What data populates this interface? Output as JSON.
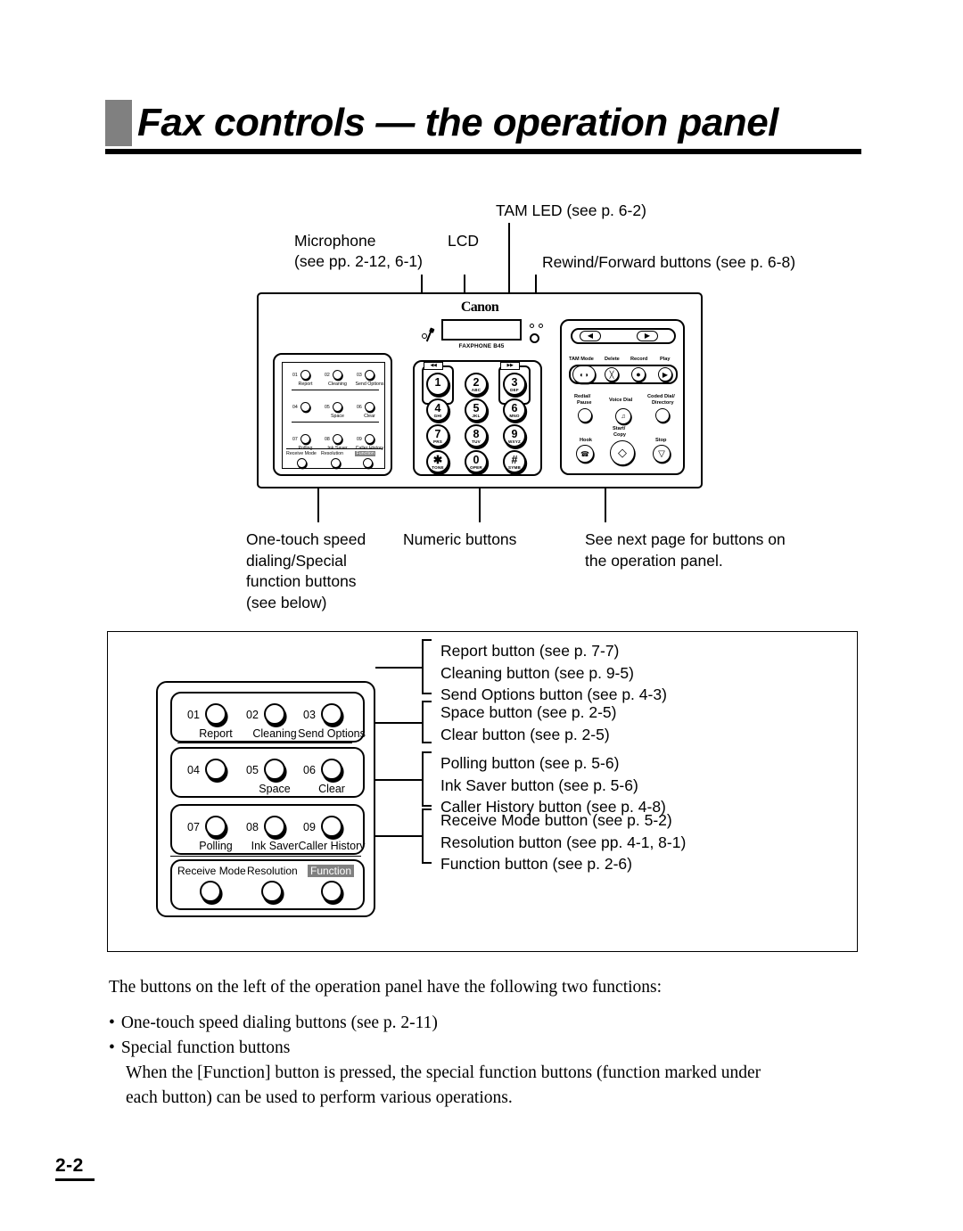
{
  "page": {
    "title": "Fax controls — the operation panel",
    "page_number": "2-2"
  },
  "diagram_top": {
    "callouts": {
      "tam_led": "TAM LED (see p. 6-2)",
      "microphone_line1": "Microphone",
      "microphone_line2": "(see pp. 2-12, 6-1)",
      "lcd": "LCD",
      "rewind_forward": "Rewind/Forward buttons (see p. 6-8)"
    },
    "bottom_callouts": {
      "one_touch_l1": "One-touch speed",
      "one_touch_l2": "dialing/Special",
      "one_touch_l3": "function buttons",
      "one_touch_l4": "(see below)",
      "numeric": "Numeric buttons",
      "next_page_l1": "See next page for buttons on",
      "next_page_l2": "the operation panel."
    }
  },
  "device": {
    "brand": "Canon",
    "model": "FAXPHONE B45",
    "one_touch_buttons": [
      {
        "num": "01",
        "label": "Report"
      },
      {
        "num": "02",
        "label": "Cleaning"
      },
      {
        "num": "03",
        "label": "Send Options"
      },
      {
        "num": "04",
        "label": ""
      },
      {
        "num": "05",
        "label": "Space"
      },
      {
        "num": "06",
        "label": "Clear"
      },
      {
        "num": "07",
        "label": "Polling"
      },
      {
        "num": "08",
        "label": "Ink Saver"
      },
      {
        "num": "09",
        "label": "Caller History"
      }
    ],
    "function_row": [
      {
        "label": "Receive Mode",
        "inverted": false
      },
      {
        "label": "Resolution",
        "inverted": false
      },
      {
        "label": "Function",
        "inverted": true
      }
    ],
    "keypad": [
      {
        "digit": "1",
        "letters": ""
      },
      {
        "digit": "2",
        "letters": "ABC"
      },
      {
        "digit": "3",
        "letters": "DEF"
      },
      {
        "digit": "4",
        "letters": "GHI"
      },
      {
        "digit": "5",
        "letters": "JKL"
      },
      {
        "digit": "6",
        "letters": "MNO"
      },
      {
        "digit": "7",
        "letters": "PRS"
      },
      {
        "digit": "8",
        "letters": "TUV"
      },
      {
        "digit": "9",
        "letters": "WXYZ"
      },
      {
        "digit": "✱",
        "letters": "TONE"
      },
      {
        "digit": "0",
        "letters": "OPER"
      },
      {
        "digit": "#",
        "letters": "SYMB"
      }
    ],
    "rewind_tab": "◀◀",
    "forward_tab": "▶▶",
    "right_cluster": {
      "nav_left": "◀",
      "nav_right": "▶",
      "tam_mode": "TAM Mode",
      "delete": "Delete",
      "record": "Record",
      "play": "Play",
      "redial_pause_l1": "Redial/",
      "redial_pause_l2": "Pause",
      "voice_dial": "Voice Dial",
      "coded_dial_l1": "Coded Dial/",
      "coded_dial_l2": "Directory",
      "hook": "Hook",
      "start_copy_l1": "Start/",
      "start_copy_l2": "Copy",
      "stop": "Stop"
    }
  },
  "lower_figure": {
    "rows": [
      {
        "buttons": [
          {
            "num": "01",
            "label": "Report"
          },
          {
            "num": "02",
            "label": "Cleaning"
          },
          {
            "num": "03",
            "label": "Send Options"
          }
        ]
      },
      {
        "buttons": [
          {
            "num": "04",
            "label": ""
          },
          {
            "num": "05",
            "label": "Space"
          },
          {
            "num": "06",
            "label": "Clear"
          }
        ]
      },
      {
        "buttons": [
          {
            "num": "07",
            "label": "Polling"
          },
          {
            "num": "08",
            "label": "Ink Saver"
          },
          {
            "num": "09",
            "label": "Caller History"
          }
        ]
      }
    ],
    "function_row": [
      {
        "label": "Receive Mode",
        "inverted": false
      },
      {
        "label": "Resolution",
        "inverted": false
      },
      {
        "label": "Function",
        "inverted": true
      }
    ],
    "callout_groups": [
      {
        "lines": [
          "Report button (see p. 7-7)",
          "Cleaning button (see p. 9-5)",
          "Send Options button (see p. 4-3)"
        ]
      },
      {
        "lines": [
          "Space button (see p. 2-5)",
          "Clear button (see p. 2-5)"
        ]
      },
      {
        "lines": [
          "Polling button (see p. 5-6)",
          "Ink Saver button (see p. 5-6)",
          "Caller History button (see p. 4-8)"
        ]
      },
      {
        "lines": [
          "Receive Mode button (see p. 5-2)",
          "Resolution button (see pp. 4-1, 8-1)",
          "Function button (see p. 2-6)"
        ]
      }
    ]
  },
  "body": {
    "intro": "The buttons on the left of the operation panel have the following two functions:",
    "bullet_marker": "•",
    "bullet1": "One-touch speed dialing buttons (see p. 2-11)",
    "bullet2": "Special function buttons",
    "bullet2_detail_l1": "When the [Function] button is pressed, the special function buttons (function marked under",
    "bullet2_detail_l2": "each button) can be used to perform various operations."
  },
  "colors": {
    "ink": "#000000",
    "gray_accent": "#808080",
    "paper": "#ffffff"
  }
}
